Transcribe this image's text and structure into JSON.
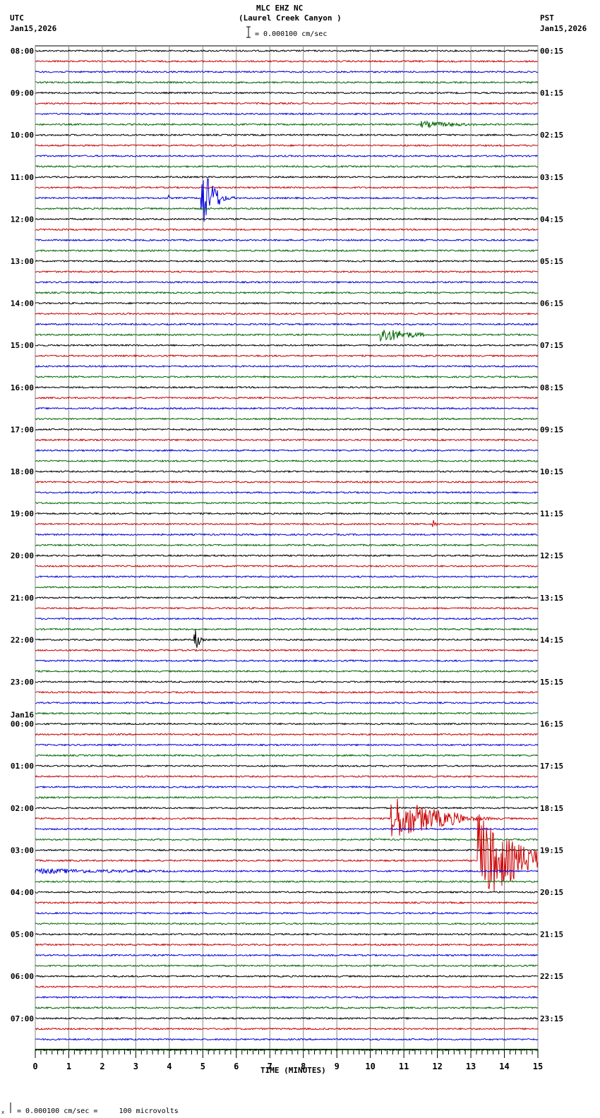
{
  "header": {
    "station": "MLC EHZ NC",
    "location": "(Laurel Creek Canyon )",
    "left_tz": "UTC",
    "left_date": "Jan15,2026",
    "right_tz": "PST",
    "right_date": "Jan15,2026",
    "scale_text": "= 0.000100 cm/sec"
  },
  "footer": {
    "scale_text": "= 0.000100 cm/sec =     100 microvolts",
    "prefix": "x"
  },
  "colors": {
    "trace_cycle": [
      "#000000",
      "#cc0000",
      "#0000dd",
      "#006600"
    ],
    "grid": "#888888"
  },
  "chart_data": {
    "type": "line",
    "title": "MLC EHZ NC (Laurel Creek Canyon )",
    "xlabel": "TIME (MINUTES)",
    "xlim": [
      0,
      15
    ],
    "x_ticks": [
      "0",
      "1",
      "2",
      "3",
      "4",
      "5",
      "6",
      "7",
      "8",
      "9",
      "10",
      "11",
      "12",
      "13",
      "14",
      "15"
    ],
    "traces_per_hour": 4,
    "trace_count": 96,
    "left_labels": [
      "08:00",
      "09:00",
      "10:00",
      "11:00",
      "12:00",
      "13:00",
      "14:00",
      "15:00",
      "16:00",
      "17:00",
      "18:00",
      "19:00",
      "20:00",
      "21:00",
      "22:00",
      "23:00",
      "00:00",
      "01:00",
      "02:00",
      "03:00",
      "04:00",
      "05:00",
      "06:00",
      "07:00"
    ],
    "date_change_label": "Jan16",
    "right_labels": [
      "00:15",
      "01:15",
      "02:15",
      "03:15",
      "04:15",
      "05:15",
      "06:15",
      "07:15",
      "08:15",
      "09:15",
      "10:15",
      "11:15",
      "12:15",
      "13:15",
      "14:15",
      "15:15",
      "16:15",
      "17:15",
      "18:15",
      "19:15",
      "20:15",
      "21:15",
      "22:15",
      "23:15"
    ],
    "events": [
      {
        "trace": 7,
        "start_min": 11.5,
        "end_min": 13.8,
        "amplitude": 5
      },
      {
        "trace": 14,
        "start_min": 4.95,
        "end_min": 5.5,
        "amplitude": 50
      },
      {
        "trace": 14,
        "start_min": 3.95,
        "end_min": 4.0,
        "amplitude": 6
      },
      {
        "trace": 27,
        "start_min": 10.3,
        "end_min": 11.6,
        "amplitude": 12
      },
      {
        "trace": 45,
        "start_min": 11.85,
        "end_min": 12.0,
        "amplitude": 8
      },
      {
        "trace": 56,
        "start_min": 4.7,
        "end_min": 4.9,
        "amplitude": 25
      },
      {
        "trace": 73,
        "start_min": 10.6,
        "end_min": 12.8,
        "amplitude": 35
      },
      {
        "trace": 77,
        "start_min": 13.2,
        "end_min": 15.0,
        "amplitude": 70
      },
      {
        "trace": 78,
        "start_min": 0.0,
        "end_min": 6.0,
        "amplitude": 4
      }
    ]
  }
}
